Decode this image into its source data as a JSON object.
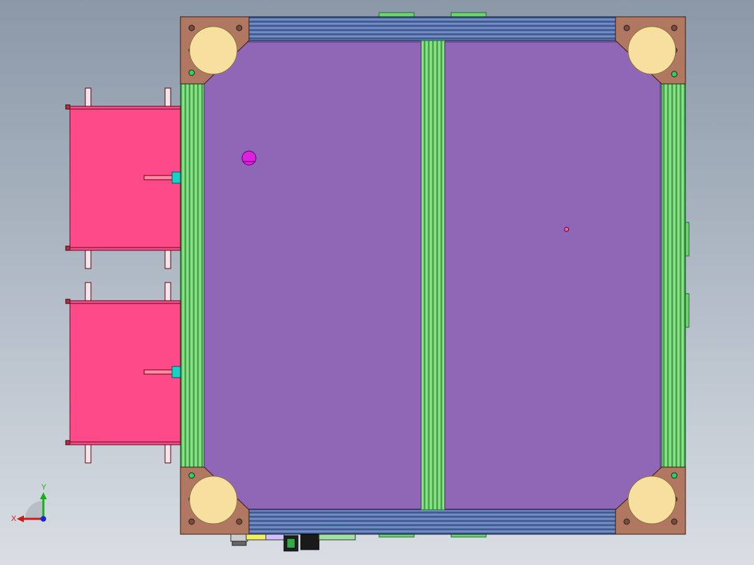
{
  "viewport": {
    "background_top": "#8a98a8",
    "background_bottom": "#d9dee4"
  },
  "colors": {
    "panel": "#8f67b6",
    "aluminum_frame": "#6fd36f",
    "aluminum_dark": "#1f6b2f",
    "blue_rail": "#5a78b0",
    "bracket": "#b07860",
    "caster": "#f7dfa0",
    "pink_box": "#ff4a8a",
    "cyan_part": "#18d0c8",
    "magenta_dot": "#e020e0"
  },
  "triad": {
    "x_label": "X",
    "y_label": "Y",
    "icon": "coordinate-triad-icon"
  }
}
